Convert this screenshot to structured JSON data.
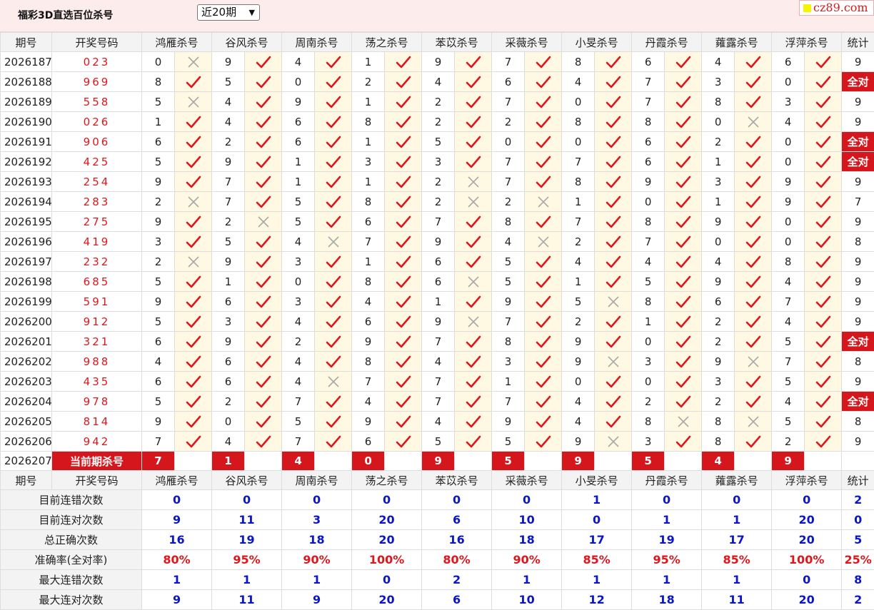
{
  "header": {
    "title": "福彩3D直选百位杀号",
    "period_selected": "近20期",
    "logo_text": "cz89.com"
  },
  "columns": {
    "period": "期号",
    "draw": "开奖号码",
    "stats": "统计",
    "experts": [
      "鸿雁杀号",
      "谷风杀号",
      "周南杀号",
      "荡之杀号",
      "苯苡杀号",
      "采薇杀号",
      "小旻杀号",
      "丹霞杀号",
      "蕹露杀号",
      "浮萍杀号"
    ]
  },
  "rows": [
    {
      "period": "2026187",
      "draw": "023",
      "kills": [
        "0",
        "9",
        "4",
        "1",
        "9",
        "7",
        "8",
        "6",
        "4",
        "6"
      ],
      "ok": [
        0,
        1,
        1,
        1,
        1,
        1,
        1,
        1,
        1,
        1
      ],
      "stat": "9"
    },
    {
      "period": "2026188",
      "draw": "969",
      "kills": [
        "8",
        "5",
        "0",
        "2",
        "4",
        "6",
        "4",
        "7",
        "3",
        "0"
      ],
      "ok": [
        1,
        1,
        1,
        1,
        1,
        1,
        1,
        1,
        1,
        1
      ],
      "stat": "全对"
    },
    {
      "period": "2026189",
      "draw": "558",
      "kills": [
        "5",
        "4",
        "9",
        "1",
        "2",
        "7",
        "0",
        "7",
        "8",
        "3"
      ],
      "ok": [
        0,
        1,
        1,
        1,
        1,
        1,
        1,
        1,
        1,
        1
      ],
      "stat": "9"
    },
    {
      "period": "2026190",
      "draw": "026",
      "kills": [
        "1",
        "4",
        "6",
        "8",
        "2",
        "2",
        "8",
        "8",
        "0",
        "4"
      ],
      "ok": [
        1,
        1,
        1,
        1,
        1,
        1,
        1,
        1,
        0,
        1
      ],
      "stat": "9"
    },
    {
      "period": "2026191",
      "draw": "906",
      "kills": [
        "6",
        "2",
        "6",
        "1",
        "5",
        "0",
        "0",
        "6",
        "2",
        "0"
      ],
      "ok": [
        1,
        1,
        1,
        1,
        1,
        1,
        1,
        1,
        1,
        1
      ],
      "stat": "全对"
    },
    {
      "period": "2026192",
      "draw": "425",
      "kills": [
        "5",
        "9",
        "1",
        "3",
        "3",
        "7",
        "7",
        "6",
        "1",
        "0"
      ],
      "ok": [
        1,
        1,
        1,
        1,
        1,
        1,
        1,
        1,
        1,
        1
      ],
      "stat": "全对"
    },
    {
      "period": "2026193",
      "draw": "254",
      "kills": [
        "9",
        "7",
        "1",
        "1",
        "2",
        "7",
        "8",
        "9",
        "3",
        "9"
      ],
      "ok": [
        1,
        1,
        1,
        1,
        0,
        1,
        1,
        1,
        1,
        1
      ],
      "stat": "9"
    },
    {
      "period": "2026194",
      "draw": "283",
      "kills": [
        "2",
        "7",
        "5",
        "8",
        "2",
        "2",
        "1",
        "0",
        "1",
        "9"
      ],
      "ok": [
        0,
        1,
        1,
        1,
        0,
        0,
        1,
        1,
        1,
        1
      ],
      "stat": "7"
    },
    {
      "period": "2026195",
      "draw": "275",
      "kills": [
        "9",
        "2",
        "5",
        "6",
        "7",
        "8",
        "7",
        "8",
        "9",
        "0"
      ],
      "ok": [
        1,
        0,
        1,
        1,
        1,
        1,
        1,
        1,
        1,
        1
      ],
      "stat": "9"
    },
    {
      "period": "2026196",
      "draw": "419",
      "kills": [
        "3",
        "5",
        "4",
        "7",
        "9",
        "4",
        "2",
        "7",
        "0",
        "0"
      ],
      "ok": [
        1,
        1,
        0,
        1,
        1,
        0,
        1,
        1,
        1,
        1
      ],
      "stat": "8"
    },
    {
      "period": "2026197",
      "draw": "232",
      "kills": [
        "2",
        "9",
        "3",
        "1",
        "6",
        "5",
        "4",
        "4",
        "4",
        "8"
      ],
      "ok": [
        0,
        1,
        1,
        1,
        1,
        1,
        1,
        1,
        1,
        1
      ],
      "stat": "9"
    },
    {
      "period": "2026198",
      "draw": "685",
      "kills": [
        "5",
        "1",
        "0",
        "8",
        "6",
        "5",
        "1",
        "5",
        "9",
        "4"
      ],
      "ok": [
        1,
        1,
        1,
        1,
        0,
        1,
        1,
        1,
        1,
        1
      ],
      "stat": "9"
    },
    {
      "period": "2026199",
      "draw": "591",
      "kills": [
        "9",
        "6",
        "3",
        "4",
        "1",
        "9",
        "5",
        "8",
        "6",
        "7"
      ],
      "ok": [
        1,
        1,
        1,
        1,
        1,
        1,
        0,
        1,
        1,
        1
      ],
      "stat": "9"
    },
    {
      "period": "2026200",
      "draw": "912",
      "kills": [
        "5",
        "3",
        "4",
        "6",
        "9",
        "7",
        "2",
        "1",
        "2",
        "4"
      ],
      "ok": [
        1,
        1,
        1,
        1,
        0,
        1,
        1,
        1,
        1,
        1
      ],
      "stat": "9"
    },
    {
      "period": "2026201",
      "draw": "321",
      "kills": [
        "6",
        "9",
        "2",
        "9",
        "7",
        "8",
        "9",
        "0",
        "2",
        "5"
      ],
      "ok": [
        1,
        1,
        1,
        1,
        1,
        1,
        1,
        1,
        1,
        1
      ],
      "stat": "全对"
    },
    {
      "period": "2026202",
      "draw": "988",
      "kills": [
        "4",
        "6",
        "4",
        "8",
        "4",
        "3",
        "9",
        "3",
        "9",
        "7"
      ],
      "ok": [
        1,
        1,
        1,
        1,
        1,
        1,
        0,
        1,
        0,
        1
      ],
      "stat": "8"
    },
    {
      "period": "2026203",
      "draw": "435",
      "kills": [
        "6",
        "6",
        "4",
        "7",
        "7",
        "1",
        "0",
        "0",
        "3",
        "5"
      ],
      "ok": [
        1,
        1,
        0,
        1,
        1,
        1,
        1,
        1,
        1,
        1
      ],
      "stat": "9"
    },
    {
      "period": "2026204",
      "draw": "978",
      "kills": [
        "5",
        "2",
        "7",
        "4",
        "7",
        "7",
        "4",
        "2",
        "2",
        "4"
      ],
      "ok": [
        1,
        1,
        1,
        1,
        1,
        1,
        1,
        1,
        1,
        1
      ],
      "stat": "全对"
    },
    {
      "period": "2026205",
      "draw": "814",
      "kills": [
        "9",
        "0",
        "5",
        "9",
        "4",
        "9",
        "4",
        "8",
        "8",
        "5"
      ],
      "ok": [
        1,
        1,
        1,
        1,
        1,
        1,
        1,
        0,
        0,
        1
      ],
      "stat": "8"
    },
    {
      "period": "2026206",
      "draw": "942",
      "kills": [
        "7",
        "4",
        "7",
        "6",
        "5",
        "5",
        "9",
        "3",
        "8",
        "2"
      ],
      "ok": [
        1,
        1,
        1,
        1,
        1,
        1,
        0,
        1,
        1,
        1
      ],
      "stat": "9"
    }
  ],
  "current": {
    "period": "2026207",
    "label": "当前期杀号",
    "kills": [
      "7",
      "1",
      "4",
      "0",
      "9",
      "5",
      "9",
      "5",
      "4",
      "9"
    ]
  },
  "stats": [
    {
      "label": "目前连错次数",
      "values": [
        "0",
        "0",
        "0",
        "0",
        "0",
        "0",
        "1",
        "0",
        "0",
        "0"
      ],
      "total": "2"
    },
    {
      "label": "目前连对次数",
      "values": [
        "9",
        "11",
        "3",
        "20",
        "6",
        "10",
        "0",
        "1",
        "1",
        "20"
      ],
      "total": "0"
    },
    {
      "label": "总正确次数",
      "values": [
        "16",
        "19",
        "18",
        "20",
        "16",
        "18",
        "17",
        "19",
        "17",
        "20"
      ],
      "total": "5"
    },
    {
      "label": "准确率(全对率)",
      "values": [
        "80%",
        "95%",
        "90%",
        "100%",
        "80%",
        "90%",
        "85%",
        "95%",
        "85%",
        "100%"
      ],
      "total": "25%"
    },
    {
      "label": "最大连错次数",
      "values": [
        "1",
        "1",
        "1",
        "0",
        "2",
        "1",
        "1",
        "1",
        "1",
        "0"
      ],
      "total": "8"
    },
    {
      "label": "最大连对次数",
      "values": [
        "9",
        "11",
        "9",
        "20",
        "6",
        "10",
        "12",
        "18",
        "11",
        "20"
      ],
      "total": "2"
    }
  ],
  "icons": {
    "correct": "check-icon",
    "wrong": "cross-icon"
  },
  "colors": {
    "check": "#e0161c",
    "cross": "#a8a8a8",
    "highlight": "#d5161c",
    "stat_value": "#0b17c7",
    "accuracy": "#e0161c"
  }
}
